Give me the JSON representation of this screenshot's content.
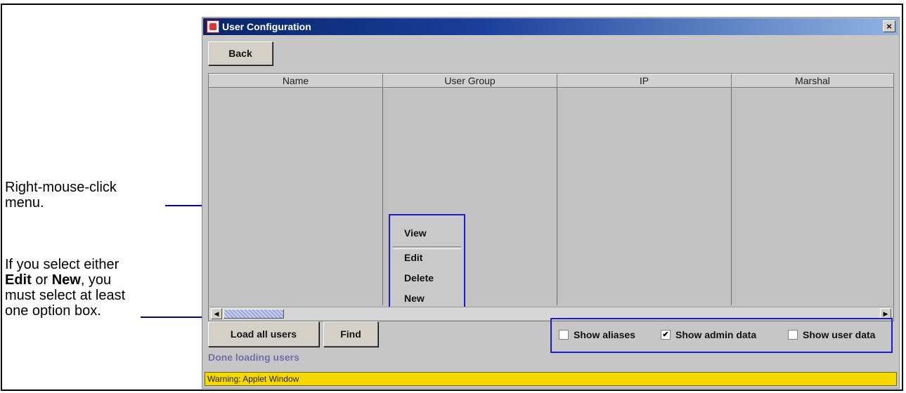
{
  "annotations": {
    "context_menu_note": "Right-mouse-click menu.",
    "options_note_prefix": "If you select either ",
    "options_note_edit": "Edit",
    "options_note_or": " or ",
    "options_note_new": "New",
    "options_note_suffix": ", you must select at least one option box."
  },
  "window": {
    "title": "User Configuration",
    "close_symbol": "×"
  },
  "toolbar": {
    "back_label": "Back"
  },
  "table": {
    "columns": [
      "Name",
      "User Group",
      "IP",
      "Marshal"
    ]
  },
  "context_menu": {
    "items": [
      "View",
      "Edit",
      "Delete",
      "New"
    ]
  },
  "actions": {
    "load_all_label": "Load all users",
    "find_label": "Find"
  },
  "options": {
    "show_aliases": {
      "label": "Show aliases",
      "checked": false
    },
    "show_admin_data": {
      "label": "Show admin data",
      "checked": true
    },
    "show_user_data": {
      "label": "Show user data",
      "checked": false
    }
  },
  "status_text": "Done loading users",
  "warning_text": "Warning: Applet Window",
  "colors": {
    "callout_blue": "#1b1be0",
    "warning_yellow": "#f5d800",
    "title_gradient_start": "#08256b"
  }
}
